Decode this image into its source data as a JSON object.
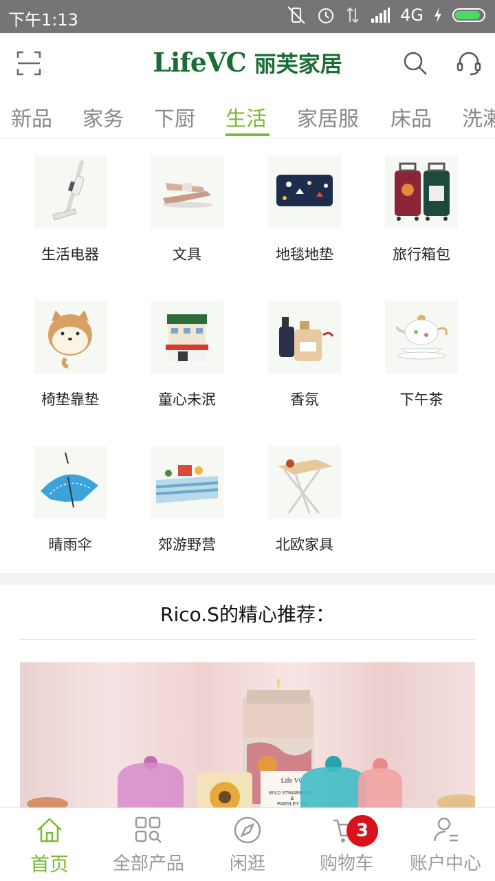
{
  "status_bar": {
    "time": "下午1:13",
    "network": "4G"
  },
  "header": {
    "logo_latin": "LifeVC",
    "logo_chinese": "丽芙家居"
  },
  "tabs": [
    {
      "label": "新品"
    },
    {
      "label": "家务"
    },
    {
      "label": "下厨"
    },
    {
      "label": "生活",
      "active": true
    },
    {
      "label": "家居服"
    },
    {
      "label": "床品"
    },
    {
      "label": "洗漱"
    }
  ],
  "categories": [
    {
      "label": "生活电器",
      "icon": "vacuum-cleaner-icon"
    },
    {
      "label": "文具",
      "icon": "stapler-icon"
    },
    {
      "label": "地毯地垫",
      "icon": "rug-icon"
    },
    {
      "label": "旅行箱包",
      "icon": "suitcase-icon"
    },
    {
      "label": "椅垫靠垫",
      "icon": "shiba-cushion-icon"
    },
    {
      "label": "童心未泯",
      "icon": "building-blocks-icon"
    },
    {
      "label": "香氛",
      "icon": "perfume-bottle-icon"
    },
    {
      "label": "下午茶",
      "icon": "teapot-icon"
    },
    {
      "label": "晴雨伞",
      "icon": "umbrella-icon"
    },
    {
      "label": "郊游野营",
      "icon": "picnic-mat-icon"
    },
    {
      "label": "北欧家具",
      "icon": "folding-table-icon"
    }
  ],
  "recommend": {
    "title": "Rico.S的精心推荐：",
    "banner_label_brand": "Life VC",
    "banner_label_line1": "WILD STRAWBERRY",
    "banner_label_line2": "&",
    "banner_label_line3": "PARSLEY BG"
  },
  "bottom_nav": [
    {
      "label": "首页",
      "icon": "home-icon",
      "active": true
    },
    {
      "label": "全部产品",
      "icon": "grid-search-icon"
    },
    {
      "label": "闲逛",
      "icon": "compass-icon"
    },
    {
      "label": "购物车",
      "icon": "cart-icon",
      "badge": "3"
    },
    {
      "label": "账户中心",
      "icon": "user-icon"
    }
  ],
  "colors": {
    "accent": "#7ab934",
    "brand": "#1a6d34",
    "badge": "#d9131b"
  }
}
